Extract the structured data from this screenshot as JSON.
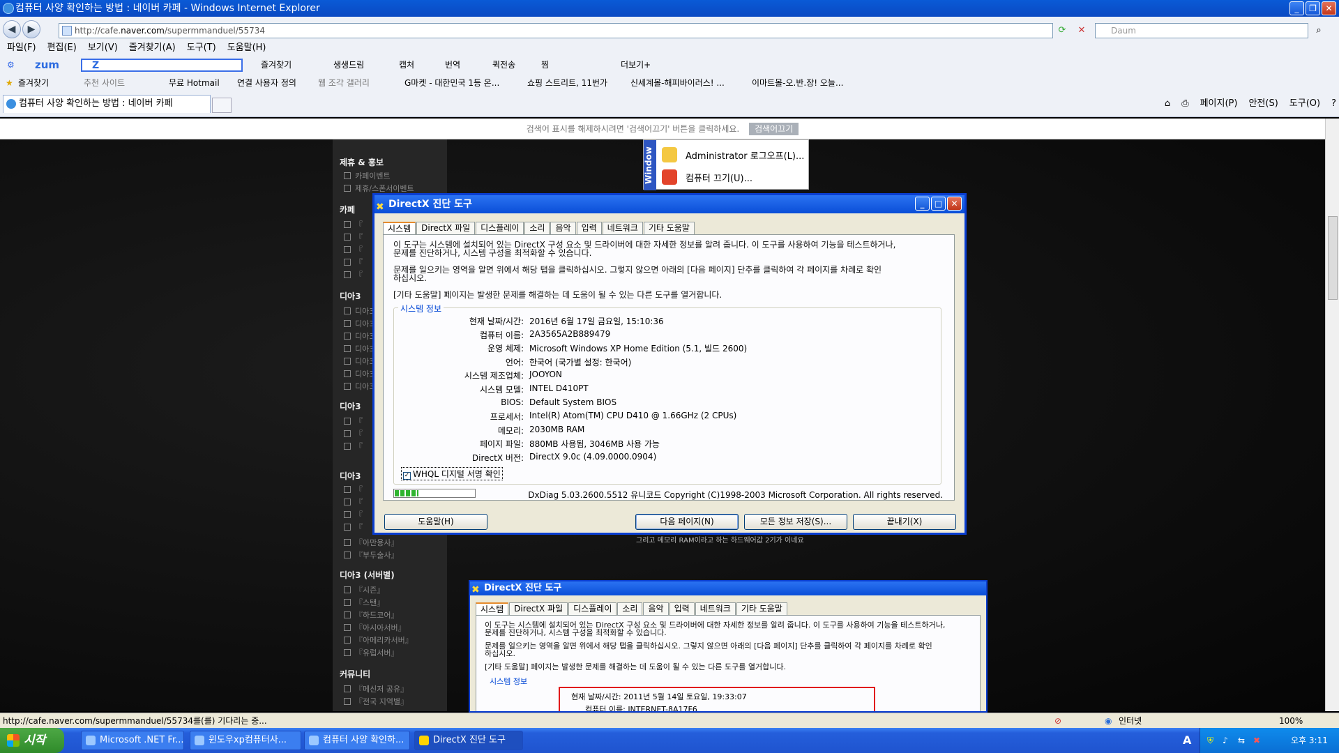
{
  "window": {
    "title": "컴퓨터 사양 확인하는 방법 : 네이버 카페 - Windows Internet Explorer"
  },
  "address": {
    "url_prefix": "http://cafe.",
    "url_domain": "naver.com",
    "url_path": "/supermmanduel/55734"
  },
  "search_box": {
    "placeholder": "Daum"
  },
  "menu": [
    "파일(F)",
    "편집(E)",
    "보기(V)",
    "즐겨찾기(A)",
    "도구(T)",
    "도움말(H)"
  ],
  "zum_toolbar": {
    "brand": "zum",
    "search_letter": "Z",
    "items": [
      "즐겨찾기",
      "생생드림",
      "캡처",
      "번역",
      "퀵전송",
      "찜",
      "더보기+"
    ]
  },
  "favorites_bar": {
    "items": [
      "즐겨찾기",
      "추천 사이트",
      "무료 Hotmail",
      "연결 사용자 정의",
      "웹 조각 갤러리",
      "G마켓 - 대한민국 1등 온...",
      "쇼핑 스트리트, 11번가",
      "신세계몰-해피바이러스! ...",
      "이마트몰-오.반.장! 오늘..."
    ]
  },
  "tab": {
    "label": "컴퓨터 사양 확인하는 방법 : 네이버 카페"
  },
  "command_bar": [
    "페이지(P)",
    "안전(S)",
    "도구(O)"
  ],
  "infobar": {
    "text": "검색어 표시를 해제하시려면 '검색어끄기' 버튼을 클릭하세요.",
    "button": "검색어끄기"
  },
  "sidebar": {
    "cats": [
      "제휴 & 홍보",
      "카페",
      "디아3",
      "디아3",
      "디아3",
      "디아3 (서버별)",
      "커뮤니티"
    ],
    "items_a": [
      "카페이벤트",
      "제휴/스폰서이벤트"
    ],
    "items_b": [
      "『아만용사』",
      "『부두술사』"
    ],
    "items_c": [
      "『시즌』",
      "『스탠』",
      "『하드코어』",
      "『아시아서버』",
      "『아메리카서버』",
      "『유럽서버』"
    ],
    "items_d": [
      "『메신저 공유』",
      "『전국 지역별』"
    ],
    "short": "『",
    "dia": "디아3"
  },
  "start_fragment": {
    "stripe": "Window",
    "logoff": "Administrator 로그오프(L)...",
    "shutdown": "컴퓨터 끄기(U)..."
  },
  "dialog_main": {
    "title": "DirectX 진단 도구",
    "tabs": [
      "시스템",
      "DirectX 파일",
      "디스플레이",
      "소리",
      "음악",
      "입력",
      "네트워크",
      "기타 도움말"
    ],
    "p1a": "이 도구는 시스템에 설치되어 있는 DirectX 구성 요소 및 드라이버에 대한 자세한 정보를 알려 줍니다. 이 도구를 사용하여 기능을 테스트하거나,",
    "p1b": "문제를 진단하거나, 시스템 구성을 최적화할 수 있습니다.",
    "p2a": "문제를 일으키는 영역을 알면 위에서 해당 탭을 클릭하십시오. 그렇지 않으면 아래의 [다음 페이지] 단추를 클릭하여 각 페이지를 차례로 확인",
    "p2b": "하십시오.",
    "p3": "[기타 도움말] 페이지는 발생한 문제를 해결하는 데 도움이 될 수 있는 다른 도구를 열거합니다.",
    "group": "시스템 정보",
    "info": [
      {
        "k": "현재 날짜/시간:",
        "v": "2016년 6월 17일 금요일, 15:10:36"
      },
      {
        "k": "컴퓨터 이름:",
        "v": "2A3565A2B889479"
      },
      {
        "k": "운영 체제:",
        "v": "Microsoft Windows XP Home Edition (5.1, 빌드 2600)"
      },
      {
        "k": "언어:",
        "v": "한국어 (국가별 설정: 한국어)"
      },
      {
        "k": "시스템 제조업체:",
        "v": "JOOYON"
      },
      {
        "k": "시스템 모델:",
        "v": "INTEL D410PT"
      },
      {
        "k": "BIOS:",
        "v": "Default System BIOS"
      },
      {
        "k": "프로세서:",
        "v": "Intel(R) Atom(TM) CPU D410   @ 1.66GHz (2 CPUs)"
      },
      {
        "k": "메모리:",
        "v": "2030MB RAM"
      },
      {
        "k": "페이지 파일:",
        "v": "880MB 사용됨, 3046MB 사용 가능"
      },
      {
        "k": "DirectX 버전:",
        "v": "DirectX 9.0c (4.09.0000.0904)"
      }
    ],
    "whql": "WHQL 디지털 서명 확인",
    "footer": "DxDiag 5.03.2600.5512 유니코드  Copyright (C)1998-2003 Microsoft Corporation.  All rights reserved.",
    "progress": 0.3,
    "buttons": {
      "help": "도움말(H)",
      "next": "다음 페이지(N)",
      "save": "모든 정보 저장(S)...",
      "exit": "끝내기(X)"
    }
  },
  "page_caption": "그리고 메모리 RAM이라고 하는 하드웨어값 2기가 이네요",
  "dialog_second": {
    "title": "DirectX 진단 도구",
    "tabs": [
      "시스템",
      "DirectX 파일",
      "디스플레이",
      "소리",
      "음악",
      "입력",
      "네트워크",
      "기타 도움말"
    ],
    "group": "시스템 정보",
    "info": [
      {
        "k": "현재 날짜/시간:",
        "v": "2011년 5월 14일 토요일, 19:33:07"
      },
      {
        "k": "컴퓨터 이름:",
        "v": "INTERNET-8A17F6"
      }
    ]
  },
  "status_bar": {
    "text": "http://cafe.naver.com/supermmanduel/55734를(를) 기다리는 중...",
    "zone": "인터넷",
    "zoom": "100%"
  },
  "taskbar": {
    "start": "시작",
    "tasks": [
      "Microsoft .NET Fr...",
      "윈도우xp컴퓨터사...",
      "컴퓨터 사양 확인하...",
      "DirectX 진단 도구"
    ],
    "clock": "오후 3:11",
    "ime": "A"
  },
  "colors": {
    "xp_blue": "#0a4ed8",
    "dialog_face": "#ece9d8",
    "group_title": "#0046d5"
  }
}
